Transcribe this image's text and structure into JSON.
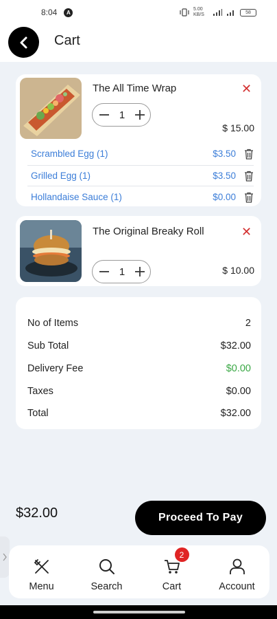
{
  "status_bar": {
    "time": "8:04",
    "app_badge": "A",
    "net_speed": "5.00 KB/S",
    "battery": "58"
  },
  "header": {
    "title": "Cart"
  },
  "items": [
    {
      "name": "The All Time Wrap",
      "quantity": "1",
      "price": "$ 15.00",
      "addons": [
        {
          "name": "Scrambled Egg (1)",
          "price": "$3.50"
        },
        {
          "name": "Grilled Egg (1)",
          "price": "$3.50"
        },
        {
          "name": "Hollandaise Sauce (1)",
          "price": "$0.00"
        }
      ]
    },
    {
      "name": "The Original Breaky Roll",
      "quantity": "1",
      "price": "$ 10.00",
      "addons": []
    }
  ],
  "summary": [
    {
      "label": "No of Items",
      "value": "2"
    },
    {
      "label": "Sub Total",
      "value": "$32.00"
    },
    {
      "label": "Delivery Fee",
      "value": "$0.00"
    },
    {
      "label": "Taxes",
      "value": "$0.00"
    },
    {
      "label": "Total",
      "value": "$32.00"
    }
  ],
  "footer": {
    "total": "$32.00",
    "pay_label": "Proceed To Pay"
  },
  "nav": [
    {
      "label": "Menu",
      "icon": "utensils-icon"
    },
    {
      "label": "Search",
      "icon": "search-icon"
    },
    {
      "label": "Cart",
      "icon": "cart-icon",
      "badge": "2"
    },
    {
      "label": "Account",
      "icon": "user-icon"
    }
  ],
  "colors": {
    "accent": "#000000",
    "addon": "#3b7dd8",
    "remove": "#d32f2f",
    "free": "#3aa845",
    "badge": "#e02424"
  }
}
